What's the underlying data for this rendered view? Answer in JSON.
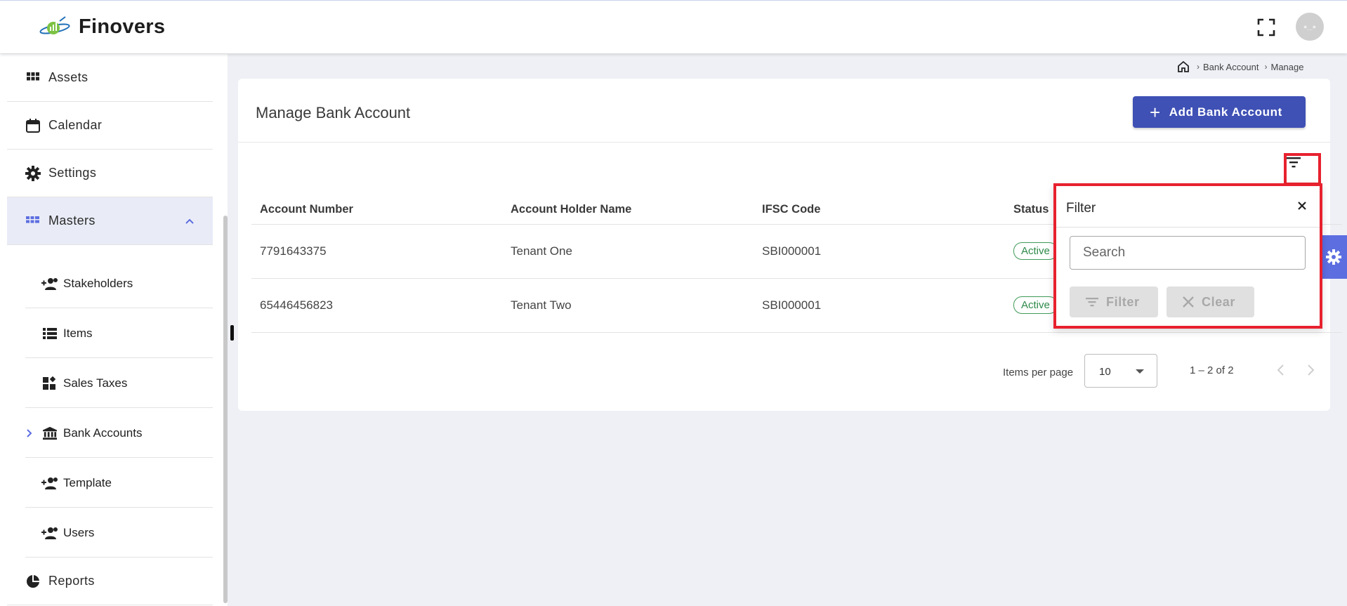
{
  "header": {
    "brand": "Finovers"
  },
  "sidebar": {
    "items": [
      {
        "label": "Assets"
      },
      {
        "label": "Calendar"
      },
      {
        "label": "Settings"
      },
      {
        "label": "Masters"
      },
      {
        "label": "Reports"
      }
    ],
    "sub_items": [
      {
        "label": "Stakeholders"
      },
      {
        "label": "Items"
      },
      {
        "label": "Sales Taxes"
      },
      {
        "label": "Bank Accounts"
      },
      {
        "label": "Template"
      },
      {
        "label": "Users"
      }
    ]
  },
  "breadcrumb": {
    "items": [
      "Bank Account",
      "Manage"
    ]
  },
  "page": {
    "title": "Manage Bank Account",
    "add_button": "Add Bank Account"
  },
  "table": {
    "columns": [
      "Account Number",
      "Account Holder Name",
      "IFSC Code",
      "Status"
    ],
    "rows": [
      {
        "account_number": "7791643375",
        "holder": "Tenant One",
        "ifsc": "SBI000001",
        "status": "Active"
      },
      {
        "account_number": "65446456823",
        "holder": "Tenant Two",
        "ifsc": "SBI000001",
        "status": "Active"
      }
    ]
  },
  "paginator": {
    "items_per_page_label": "Items per page",
    "items_per_page": "10",
    "range": "1 – 2 of 2"
  },
  "filter_panel": {
    "title": "Filter",
    "search_placeholder": "Search",
    "filter_button": "Filter",
    "clear_button": "Clear"
  },
  "colors": {
    "primary": "#3f51b5",
    "highlight": "#e8212e",
    "status_active": "#2e8a4a",
    "settings_tab": "#5d6ee0"
  }
}
